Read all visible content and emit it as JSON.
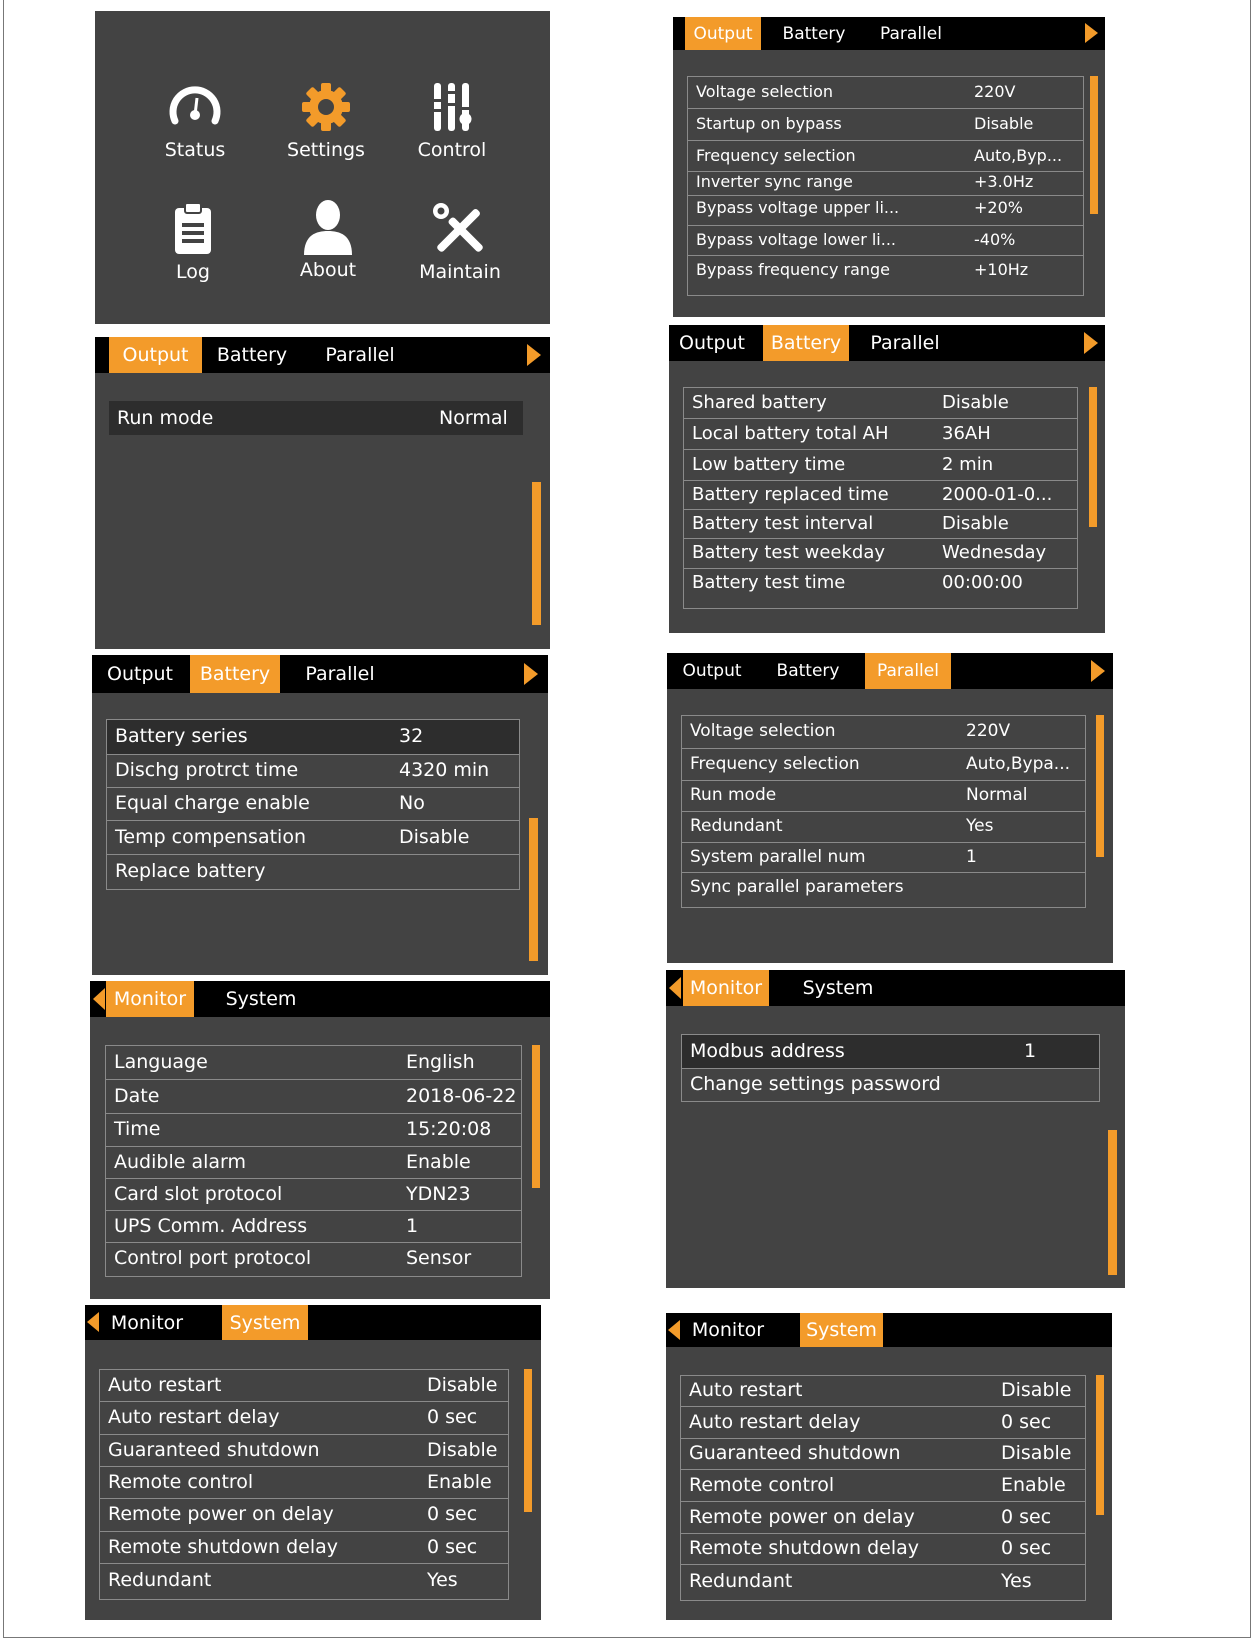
{
  "colors": {
    "accent": "#f39b2a",
    "screen_bg": "#434343",
    "tabbar_bg": "#000000",
    "text": "#ffffff",
    "divider": "#8a8a8a"
  },
  "main_menu": {
    "items": [
      {
        "label": "Status",
        "icon": "gauge-icon"
      },
      {
        "label": "Settings",
        "icon": "gear-icon"
      },
      {
        "label": "Control",
        "icon": "sliders-icon"
      },
      {
        "label": "Log",
        "icon": "clipboard-icon"
      },
      {
        "label": "About",
        "icon": "user-icon"
      },
      {
        "label": "Maintain",
        "icon": "tools-icon"
      }
    ]
  },
  "screens": {
    "output_run_mode": {
      "tabs": [
        "Output",
        "Battery",
        "Parallel"
      ],
      "rows": [
        {
          "label": "Run mode",
          "value": "Normal"
        }
      ]
    },
    "output_settings": {
      "tabs": [
        "Output",
        "Battery",
        "Parallel"
      ],
      "rows": [
        {
          "label": "Voltage selection",
          "value": "220V"
        },
        {
          "label": "Startup on bypass",
          "value": "Disable"
        },
        {
          "label": "Frequency selection",
          "value": "Auto,Byp..."
        },
        {
          "label": "Inverter sync range",
          "value": "+3.0Hz"
        },
        {
          "label": "Bypass voltage upper li...",
          "value": "+20%"
        },
        {
          "label": "Bypass voltage lower li...",
          "value": "-40%"
        },
        {
          "label": "Bypass frequency range",
          "value": "+10Hz"
        }
      ]
    },
    "battery_settings_1": {
      "tabs": [
        "Output",
        "Battery",
        "Parallel"
      ],
      "rows": [
        {
          "label": "Shared battery",
          "value": "Disable"
        },
        {
          "label": "Local battery total AH",
          "value": "36AH"
        },
        {
          "label": "Low battery time",
          "value": "2 min"
        },
        {
          "label": "Battery replaced time",
          "value": "2000-01-0..."
        },
        {
          "label": "Battery test interval",
          "value": "Disable"
        },
        {
          "label": "Battery test weekday",
          "value": "Wednesday"
        },
        {
          "label": "Battery test time",
          "value": "00:00:00"
        }
      ]
    },
    "battery_settings_2": {
      "tabs": [
        "Output",
        "Battery",
        "Parallel"
      ],
      "rows": [
        {
          "label": "Battery series",
          "value": "32"
        },
        {
          "label": "Dischg protrct time",
          "value": "4320 min"
        },
        {
          "label": "Equal charge enable",
          "value": "No"
        },
        {
          "label": "Temp compensation",
          "value": "Disable"
        },
        {
          "label": "Replace battery",
          "value": ""
        }
      ]
    },
    "parallel_settings": {
      "tabs": [
        "Output",
        "Battery",
        "Parallel"
      ],
      "rows": [
        {
          "label": "Voltage selection",
          "value": "220V"
        },
        {
          "label": "Frequency selection",
          "value": "Auto,Bypa..."
        },
        {
          "label": "Run mode",
          "value": "Normal"
        },
        {
          "label": "Redundant",
          "value": "Yes"
        },
        {
          "label": "System parallel num",
          "value": "1"
        },
        {
          "label": "Sync parallel parameters",
          "value": ""
        }
      ]
    },
    "monitor_settings": {
      "tabs": [
        "Monitor",
        "System"
      ],
      "rows": [
        {
          "label": "Language",
          "value": "English"
        },
        {
          "label": "Date",
          "value": "2018-06-22"
        },
        {
          "label": "Time",
          "value": "15:20:08"
        },
        {
          "label": "Audible alarm",
          "value": "Enable"
        },
        {
          "label": "Card slot protocol",
          "value": "YDN23"
        },
        {
          "label": "UPS Comm. Address",
          "value": "1"
        },
        {
          "label": "Control port protocol",
          "value": "Sensor"
        }
      ]
    },
    "monitor_modbus": {
      "tabs": [
        "Monitor",
        "System"
      ],
      "rows": [
        {
          "label": "Modbus address",
          "value": "1"
        },
        {
          "label": "Change settings password",
          "value": ""
        }
      ]
    },
    "system_settings_a": {
      "tabs": [
        "Monitor",
        "System"
      ],
      "rows": [
        {
          "label": "Auto restart",
          "value": "Disable"
        },
        {
          "label": "Auto restart delay",
          "value": "0 sec"
        },
        {
          "label": "Guaranteed shutdown",
          "value": "Disable"
        },
        {
          "label": "Remote control",
          "value": "Enable"
        },
        {
          "label": "Remote power on delay",
          "value": "0 sec"
        },
        {
          "label": "Remote shutdown delay",
          "value": "0 sec"
        },
        {
          "label": "Redundant",
          "value": "Yes"
        }
      ]
    },
    "system_settings_b": {
      "tabs": [
        "Monitor",
        "System"
      ],
      "rows": [
        {
          "label": "Auto restart",
          "value": "Disable"
        },
        {
          "label": "Auto restart delay",
          "value": "0 sec"
        },
        {
          "label": "Guaranteed shutdown",
          "value": "Disable"
        },
        {
          "label": "Remote control",
          "value": "Enable"
        },
        {
          "label": "Remote power on delay",
          "value": "0 sec"
        },
        {
          "label": "Remote shutdown delay",
          "value": "0 sec"
        },
        {
          "label": "Redundant",
          "value": "Yes"
        }
      ]
    }
  }
}
